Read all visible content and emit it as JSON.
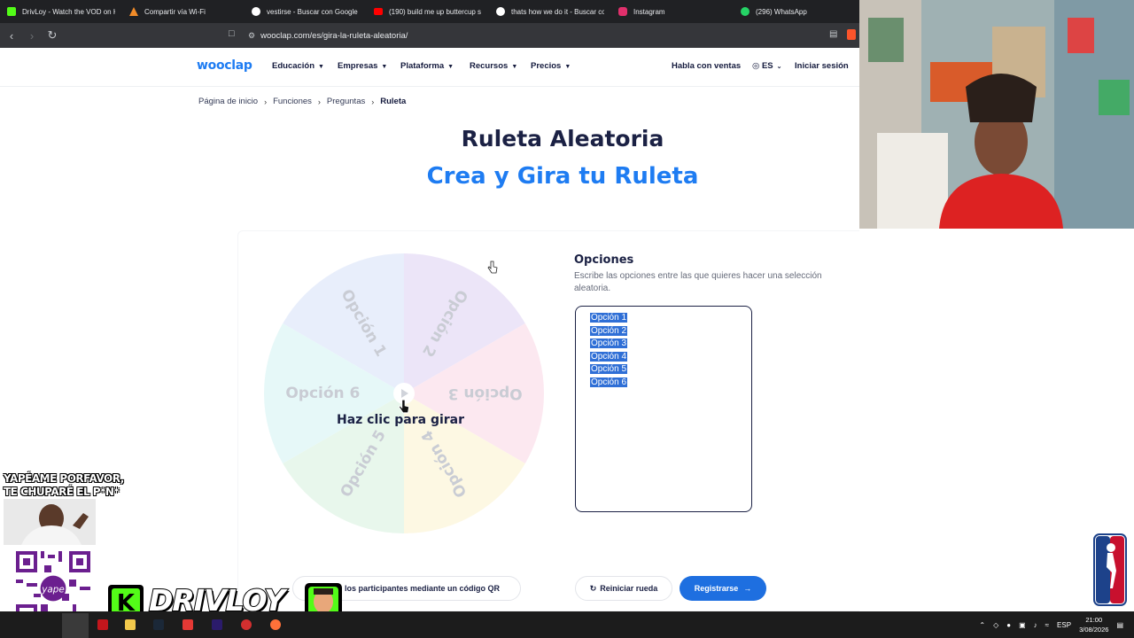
{
  "browser": {
    "tabs": [
      {
        "title": "DrivLoy - Watch the VOD on K",
        "icon_color": "#53fc18"
      },
      {
        "title": "Compartir vía Wi-Fi",
        "icon_color": "#f28c28"
      },
      {
        "title": "vestirse - Buscar con Google",
        "icon_color": "#ffffff"
      },
      {
        "title": "(190) build me up buttercup s",
        "icon_color": "#ff0000"
      },
      {
        "title": "thats how we do it - Buscar co",
        "icon_color": "#ffffff"
      },
      {
        "title": "Instagram",
        "icon_color": "#e1306c"
      },
      {
        "title": "(296) WhatsApp",
        "icon_color": "#25d366"
      }
    ],
    "url": "wooclap.com/es/gira-la-ruleta-aleatoria/"
  },
  "site": {
    "logo": "wooclap",
    "nav": [
      "Educación",
      "Empresas",
      "Plataforma",
      "Recursos",
      "Precios"
    ],
    "contact_sales": "Habla con ventas",
    "language": "ES",
    "login": "Iniciar sesión",
    "breadcrumb": [
      "Página de inicio",
      "Funciones",
      "Preguntas",
      "Ruleta"
    ],
    "title": "Ruleta Aleatoria",
    "subtitle": "Crea y Gira tu Ruleta",
    "wheel": {
      "spin_label": "Haz clic para girar",
      "segments": [
        {
          "label": "Opción 1",
          "color": "#e8eefb"
        },
        {
          "label": "Opción 2",
          "color": "#ece5f8"
        },
        {
          "label": "Opción 3",
          "color": "#fce8f0"
        },
        {
          "label": "Opción 4",
          "color": "#fdf8e3"
        },
        {
          "label": "Opción 5",
          "color": "#e8f7ec"
        },
        {
          "label": "Opción 6",
          "color": "#e6f8f8"
        }
      ]
    },
    "options_panel": {
      "title": "Opciones",
      "description": "Escribe las opciones entre las que quieres hacer una selección aleatoria.",
      "options": [
        "Opción 1",
        "Opción 2",
        "Opción 3",
        "Opción 4",
        "Opción 5",
        "Opción 6"
      ]
    },
    "buttons": {
      "qr": "los participantes mediante un código QR",
      "reset": "Reiniciar rueda",
      "register": "Registrarse"
    }
  },
  "overlays": {
    "yape_line1": "YAPÉAME PORFAVOR,",
    "yape_line2": "TE CHUPARÉ  EL P*N*",
    "qr_brand": "yape",
    "channel_name": "DRIVLOY",
    "channel_badge": "K"
  },
  "taskbar": {
    "language": "ESP",
    "time": "21:00",
    "date": "3/08/2026"
  },
  "colors": {
    "brand_blue": "#1e7cf2",
    "navy": "#1b2144",
    "selection": "#2f6fd6"
  }
}
